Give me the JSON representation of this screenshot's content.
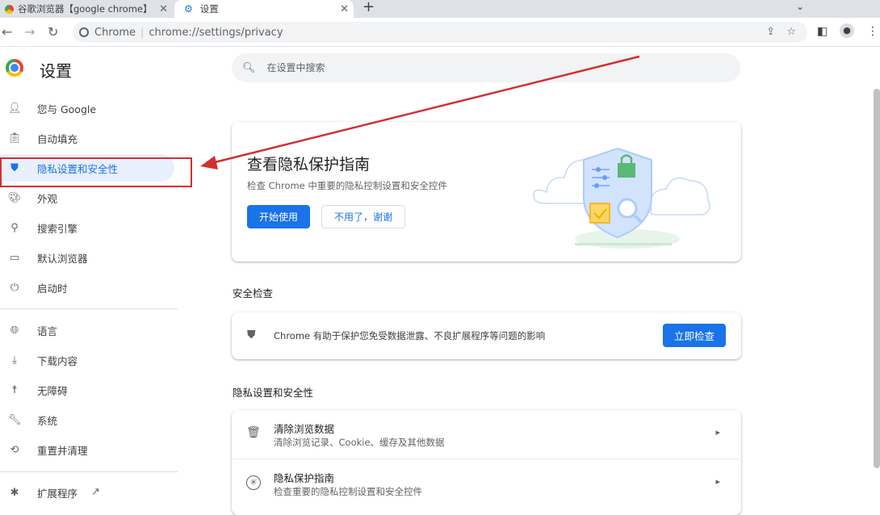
{
  "tabs": [
    {
      "title": "谷歌浏览器【google chrome】",
      "close": "✕"
    },
    {
      "title": "设置",
      "close": "✕"
    }
  ],
  "new_tab_label": "+",
  "tab_menu_label": "⌄",
  "omnibox": {
    "site": "Chrome",
    "separator": "|",
    "url": "chrome://settings/privacy"
  },
  "header": {
    "title": "设置",
    "search_placeholder": "在设置中搜索"
  },
  "sidebar": {
    "items": [
      {
        "label": "您与 Google",
        "icon": "person-icon"
      },
      {
        "label": "自动填充",
        "icon": "clipboard-icon"
      },
      {
        "label": "隐私设置和安全性",
        "icon": "shield-icon"
      },
      {
        "label": "外观",
        "icon": "palette-icon"
      },
      {
        "label": "搜索引擎",
        "icon": "search-icon"
      },
      {
        "label": "默认浏览器",
        "icon": "browser-icon"
      },
      {
        "label": "启动时",
        "icon": "power-icon"
      },
      {
        "label": "语言",
        "icon": "globe-icon"
      },
      {
        "label": "下载内容",
        "icon": "download-icon"
      },
      {
        "label": "无障碍",
        "icon": "accessibility-icon"
      },
      {
        "label": "系统",
        "icon": "wrench-icon"
      },
      {
        "label": "重置并清理",
        "icon": "history-icon"
      },
      {
        "label": "扩展程序",
        "icon": "puzzle-icon"
      }
    ],
    "active_index": 2
  },
  "guide_card": {
    "title": "查看隐私保护指南",
    "description": "检查 Chrome 中重要的隐私控制设置和安全控件",
    "start_label": "开始使用",
    "decline_label": "不用了，谢谢"
  },
  "safety_check": {
    "section_title": "安全检查",
    "text": "Chrome 有助于保护您免受数据泄露、不良扩展程序等问题的影响",
    "button_label": "立即检查"
  },
  "privacy_section": {
    "section_title": "隐私设置和安全性",
    "rows": [
      {
        "title": "清除浏览数据",
        "subtitle": "清除浏览记录、Cookie、缓存及其他数据",
        "icon": "trash-icon"
      },
      {
        "title": "隐私保护指南",
        "subtitle": "检查重要的隐私控制设置和安全控件",
        "icon": "compass-icon"
      }
    ]
  },
  "colors": {
    "accent": "#1a73e8",
    "annotation": "#d32f2f",
    "active_bg": "#e8f0fe"
  }
}
